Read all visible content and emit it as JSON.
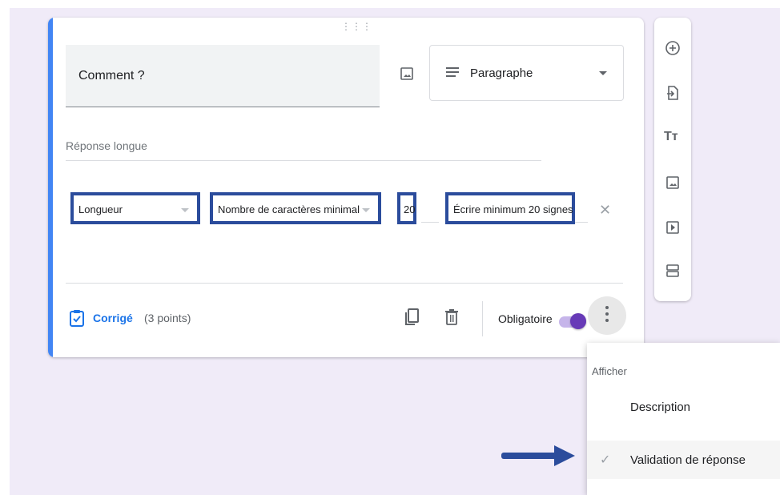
{
  "question": {
    "title": "Comment ?",
    "type_label": "Paragraphe",
    "answer_placeholder": "Réponse longue"
  },
  "validation": {
    "criterion": "Longueur",
    "rule": "Nombre de caractères minimal",
    "value": "20",
    "error_text": "Écrire minimum 20 signes"
  },
  "footer": {
    "answer_key_label": "Corrigé",
    "points": "(3 points)",
    "required_label": "Obligatoire",
    "required_on": true
  },
  "menu": {
    "header": "Afficher",
    "items": [
      {
        "label": "Description",
        "checked": false
      },
      {
        "label": "Validation de réponse",
        "checked": true
      }
    ]
  },
  "colors": {
    "accent_blue": "#4285f4",
    "highlight_box": "#2b4c9c",
    "toggle_purple": "#673ab7",
    "link_blue": "#1a73e8",
    "background": "#f0ebf8"
  },
  "icons": {
    "side_toolbar": [
      "add-question-icon",
      "import-questions-icon",
      "add-title-icon",
      "add-image-icon",
      "add-video-icon",
      "add-section-icon"
    ]
  }
}
